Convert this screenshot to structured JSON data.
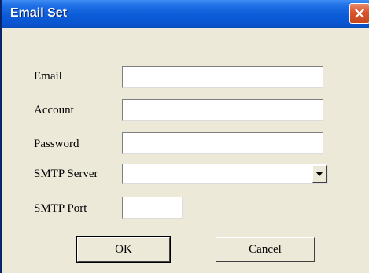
{
  "dialog": {
    "title": "Email Set"
  },
  "form": {
    "email_label": "Email",
    "email_value": "",
    "account_label": "Account",
    "account_value": "",
    "password_label": "Password",
    "password_value": "",
    "smtp_server_label": "SMTP Server",
    "smtp_server_value": "",
    "smtp_port_label": "SMTP Port",
    "smtp_port_value": ""
  },
  "buttons": {
    "ok_label": "OK",
    "cancel_label": "Cancel"
  },
  "icons": {
    "close": "close-icon",
    "dropdown": "chevron-down-icon"
  },
  "colors": {
    "titlebar": "#0A55D0",
    "close_button": "#D9542C",
    "dialog_background": "#ECE9D8"
  }
}
